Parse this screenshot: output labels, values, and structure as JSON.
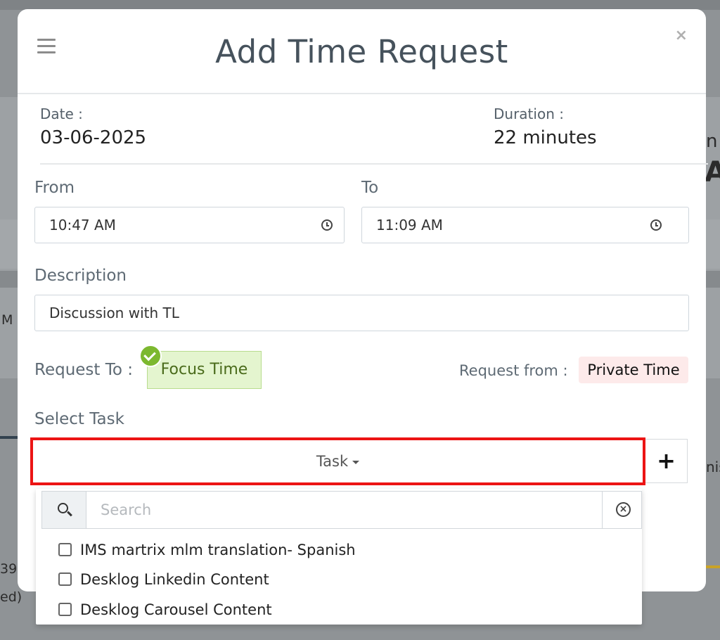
{
  "background": {
    "fragment_right_1": "n",
    "fragment_right_2": "A",
    "fragment_left_1": "M",
    "fragment_left_2": "39",
    "fragment_left_3": "ed)",
    "fragment_right_3": "nis"
  },
  "modal": {
    "title": "Add Time Request",
    "close_glyph": "×",
    "date_label": "Date :",
    "date_value": "03-06-2025",
    "duration_label": "Duration :",
    "duration_value": "22 minutes",
    "from_label": "From",
    "from_value": "10:47 AM",
    "to_label": "To",
    "to_value": "11:09 AM",
    "description_label": "Description",
    "description_value": "Discussion with TL",
    "request_to_label": "Request To :",
    "request_to_value": "Focus Time",
    "request_from_label": "Request from :",
    "request_from_value": "Private Time",
    "select_task_label": "Select Task",
    "task_button_label": "Task",
    "add_glyph": "+"
  },
  "dropdown": {
    "search_placeholder": "Search",
    "options": [
      {
        "label": "IMS martrix mlm translation- Spanish",
        "checked": false
      },
      {
        "label": "Desklog Linkedin Content",
        "checked": false
      },
      {
        "label": "Desklog Carousel Content",
        "checked": false
      }
    ]
  },
  "colors": {
    "highlight_border": "#ec1414",
    "focus_green": "#7cb82f",
    "title_color": "#46525c"
  }
}
